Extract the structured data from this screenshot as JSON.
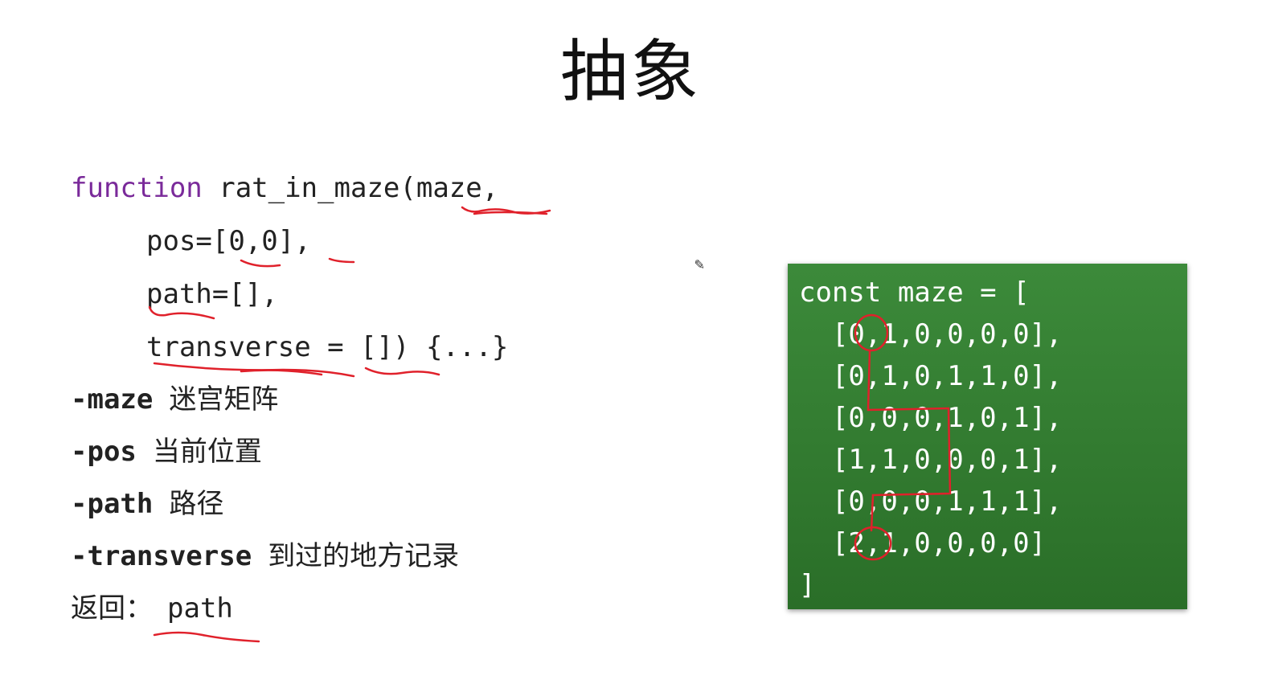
{
  "slide": {
    "title": "抽象",
    "code": {
      "keyword": "function",
      "line1_rest": " rat_in_maze(maze,",
      "line2": "pos=[0,0],",
      "line3": "path=[],",
      "line4": "transverse = []) {...}"
    },
    "params": [
      {
        "dash": "-",
        "term": "maze",
        "desc": "迷宫矩阵"
      },
      {
        "dash": "-",
        "term": "pos",
        "desc": "当前位置"
      },
      {
        "dash": "-",
        "term": "path",
        "desc": "路径"
      },
      {
        "dash": "-",
        "term": "transverse",
        "desc": "到过的地方记录"
      }
    ],
    "returns": {
      "label": "返回：",
      "value": "path"
    },
    "maze_box": {
      "lines": [
        "const maze = [",
        "  [0,1,0,0,0,0],",
        "  [0,1,0,1,1,0],",
        "  [0,0,0,1,0,1],",
        "  [1,1,0,0,0,1],",
        "  [0,0,0,1,1,1],",
        "  [2,1,0,0,0,0]",
        "]"
      ]
    },
    "colors": {
      "keyword": "#7a2a9a",
      "annotation": "#e0212b",
      "box": "#2f7a2d"
    }
  }
}
